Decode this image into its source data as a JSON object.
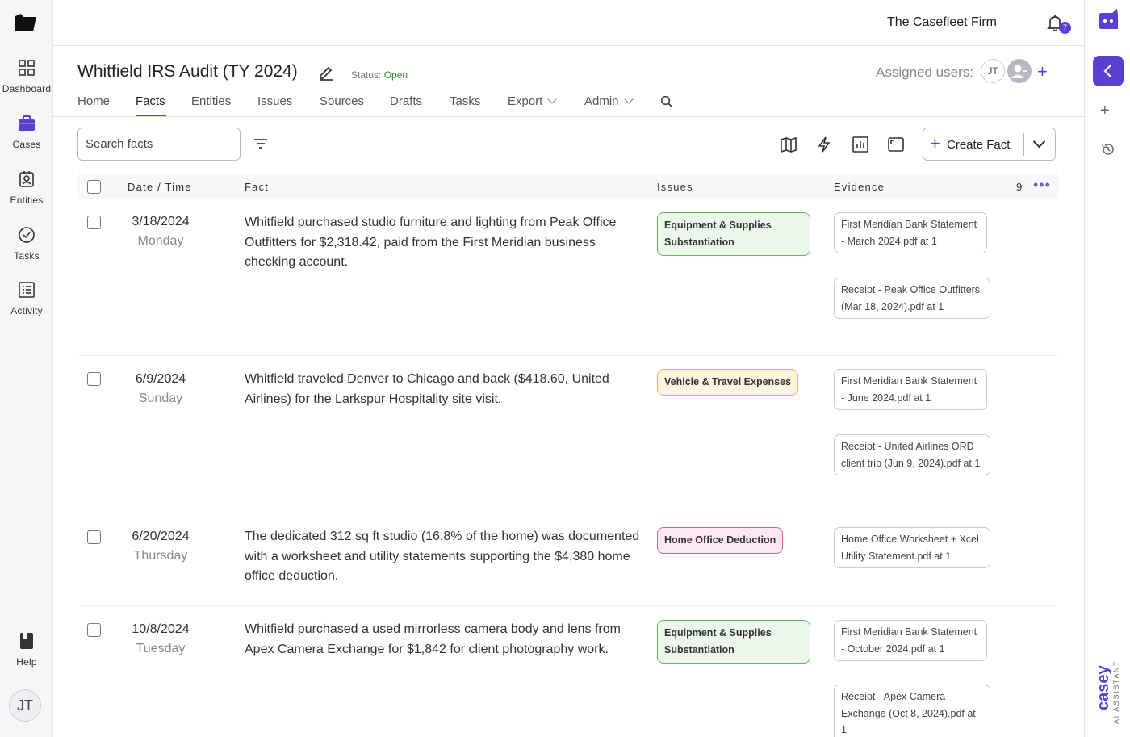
{
  "sidebar": {
    "items": [
      {
        "label": "Dashboard"
      },
      {
        "label": "Cases"
      },
      {
        "label": "Entities"
      },
      {
        "label": "Tasks"
      },
      {
        "label": "Activity"
      }
    ],
    "help_label": "Help",
    "user_initials": "JT"
  },
  "header": {
    "firm": "The Casefleet Firm",
    "notification_count": "7"
  },
  "case": {
    "title": "Whitfield IRS Audit (TY 2024)",
    "status_label": "Status:",
    "status_value": "Open",
    "assigned_label": "Assigned users:",
    "assigned_initials": "JT"
  },
  "tabs": [
    {
      "label": "Home"
    },
    {
      "label": "Facts"
    },
    {
      "label": "Entities"
    },
    {
      "label": "Issues"
    },
    {
      "label": "Sources"
    },
    {
      "label": "Drafts"
    },
    {
      "label": "Tasks"
    },
    {
      "label": "Export"
    },
    {
      "label": "Admin"
    }
  ],
  "toolbar": {
    "search_placeholder": "Search facts",
    "create_label": "Create Fact"
  },
  "table": {
    "headers": {
      "date": "Date / Time",
      "fact": "Fact",
      "issues": "Issues",
      "evidence": "Evidence"
    },
    "count": "9",
    "rows": [
      {
        "date": "3/18/2024",
        "weekday": "Monday",
        "fact": "Whitfield purchased studio furniture and lighting from Peak Office Outfitters for $2,318.42, paid from the First Meridian business checking account.",
        "issue": "Equipment & Supplies Substantiation",
        "evidence": [
          "First Meridian Bank Statement - March 2024.pdf at 1",
          "Receipt - Peak Office Outfitters (Mar 18, 2024).pdf at 1"
        ]
      },
      {
        "date": "6/9/2024",
        "weekday": "Sunday",
        "fact": "Whitfield traveled Denver to Chicago and back ($418.60, United Airlines) for the Larkspur Hospitality site visit.",
        "issue": "Vehicle & Travel Expenses",
        "evidence": [
          "First Meridian Bank Statement - June 2024.pdf at 1",
          "Receipt - United Airlines ORD client trip (Jun 9, 2024).pdf at 1"
        ]
      },
      {
        "date": "6/20/2024",
        "weekday": "Thursday",
        "fact": "The dedicated 312 sq ft studio (16.8% of the home) was documented with a worksheet and utility statements supporting the $4,380 home office deduction.",
        "issue": "Home Office Deduction",
        "evidence": [
          "Home Office Worksheet + Xcel Utility Statement.pdf at 1"
        ]
      },
      {
        "date": "10/8/2024",
        "weekday": "Tuesday",
        "fact": "Whitfield purchased a used mirrorless camera body and lens from Apex Camera Exchange for $1,842 for client photography work.",
        "issue": "Equipment & Supplies Substantiation",
        "evidence": [
          "First Meridian Bank Statement - October 2024.pdf at 1",
          "Receipt - Apex Camera Exchange (Oct 8, 2024).pdf at 1"
        ]
      }
    ]
  },
  "assistant": {
    "brand": "casey",
    "subtitle": "AI ASSISTANT"
  },
  "colors": {
    "accent": "#5b3fd1",
    "status_open": "#2e8b2e"
  }
}
